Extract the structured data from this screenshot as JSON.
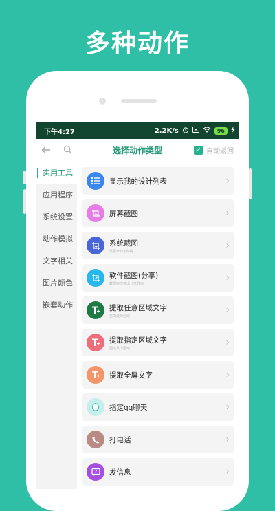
{
  "headline": "多种动作",
  "status_bar": {
    "time": "下午4:27",
    "net_speed": "2.2K/s",
    "battery": "96"
  },
  "nav": {
    "title": "选择动作类型",
    "auto_return": "自动返回"
  },
  "sidebar": {
    "items": [
      {
        "label": "实用工具"
      },
      {
        "label": "应用程序"
      },
      {
        "label": "系统设置"
      },
      {
        "label": "动作模拟"
      },
      {
        "label": "文字相关"
      },
      {
        "label": "图片颜色"
      },
      {
        "label": "嵌套动作"
      }
    ]
  },
  "actions": [
    {
      "label": "显示我的设计列表",
      "sub": "",
      "icon": "list-icon",
      "color": "#3b87f0"
    },
    {
      "label": "屏幕截图",
      "sub": "",
      "icon": "screenshot-icon",
      "color": "#e67de6"
    },
    {
      "label": "系统截图",
      "sub": "需要开启无障碍",
      "icon": "system-screenshot-icon",
      "color": "#4a66d6"
    },
    {
      "label": "软件截图(分享)",
      "sub": "截图完成将出分享界面",
      "icon": "share-screenshot-icon",
      "color": "#26b8ea"
    },
    {
      "label": "提取任意区域文字",
      "sub": "自由选择区域",
      "icon": "text-extract-icon",
      "color": "#1f7a45"
    },
    {
      "label": "提取指定区域文字",
      "sub": "固定某个区域",
      "icon": "text-extract-area-icon",
      "color": "#ee6f7b"
    },
    {
      "label": "提取全屏文字",
      "sub": "",
      "icon": "text-extract-fullscreen-icon",
      "color": "#f4956a"
    },
    {
      "label": "指定qq聊天",
      "sub": "",
      "icon": "qq-chat-icon",
      "color": "#c6eeec"
    },
    {
      "label": "打电话",
      "sub": "",
      "icon": "phone-icon",
      "color": "#b98b84"
    },
    {
      "label": "发信息",
      "sub": "",
      "icon": "message-icon",
      "color": "#a54fe0"
    }
  ],
  "colors": {
    "background": "#2fbfa6",
    "status_bar": "#12452f",
    "accent": "#26b28e"
  }
}
